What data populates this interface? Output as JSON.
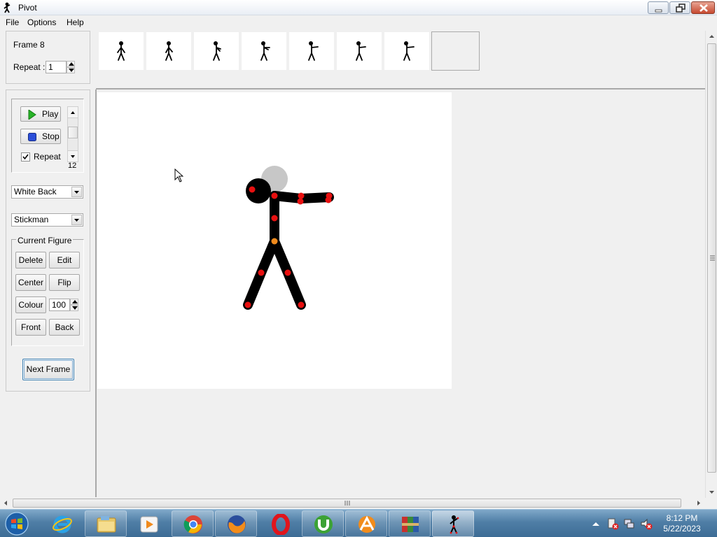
{
  "window": {
    "title": "Pivot"
  },
  "menu": [
    "File",
    "Options",
    "Help"
  ],
  "frame_panel": {
    "frame_label": "Frame 8",
    "repeat_label": "Repeat :",
    "repeat_value": "1"
  },
  "playback": {
    "play_label": "Play",
    "stop_label": "Stop",
    "repeat_label": "Repeat",
    "repeat_checked": true,
    "speed_value": "12"
  },
  "background_select": {
    "selected": "White Back"
  },
  "figure_select": {
    "selected": "Stickman"
  },
  "current_figure": {
    "group_label": "Current Figure",
    "delete_label": "Delete",
    "edit_label": "Edit",
    "center_label": "Center",
    "flip_label": "Flip",
    "colour_label": "Colour",
    "colour_value": "100",
    "front_label": "Front",
    "back_label": "Back"
  },
  "next_frame_label": "Next Frame",
  "timeline": {
    "frame_count": 7,
    "empty_slot": true
  },
  "figure": {
    "color": "#000000",
    "handle_color": "#e81010",
    "origin_handle_color": "#f08a1c",
    "ghost_head_color": "#c7c7c7"
  },
  "taskbar": {
    "items": [
      "internet-explorer-icon",
      "file-explorer-icon",
      "media-player-icon",
      "chrome-icon",
      "firefox-icon",
      "opera-icon",
      "utorrent-icon",
      "avast-icon",
      "winrar-icon",
      "pivot-icon"
    ],
    "time": "8:12 PM",
    "date": "5/22/2023"
  }
}
